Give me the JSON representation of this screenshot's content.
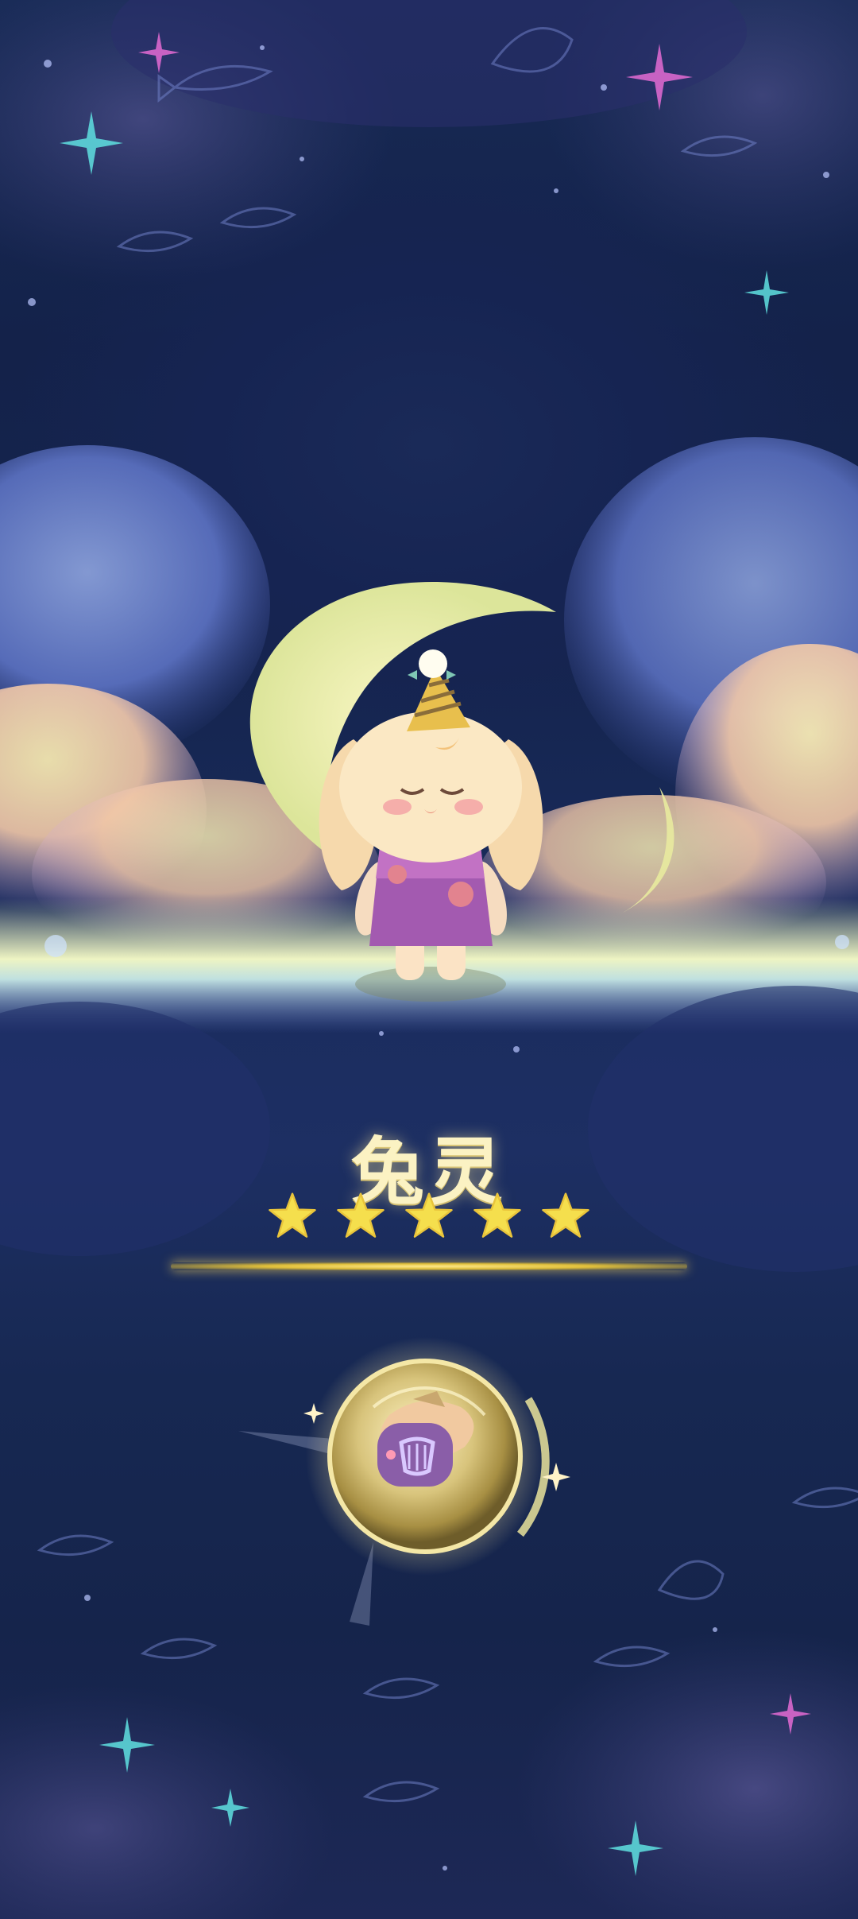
{
  "character": {
    "name": "兔灵",
    "rating": 5,
    "max_rating": 5
  },
  "colors": {
    "star_fill": "#f5df4d",
    "star_outline": "#e9c43b",
    "name_text": "#fbf2c3",
    "gold_line": "#e0bf3a",
    "moon": "#f3f1b2"
  },
  "icons": {
    "reward": "harp-gift-icon",
    "sparkle": "sparkle-icon",
    "star": "star-icon"
  }
}
